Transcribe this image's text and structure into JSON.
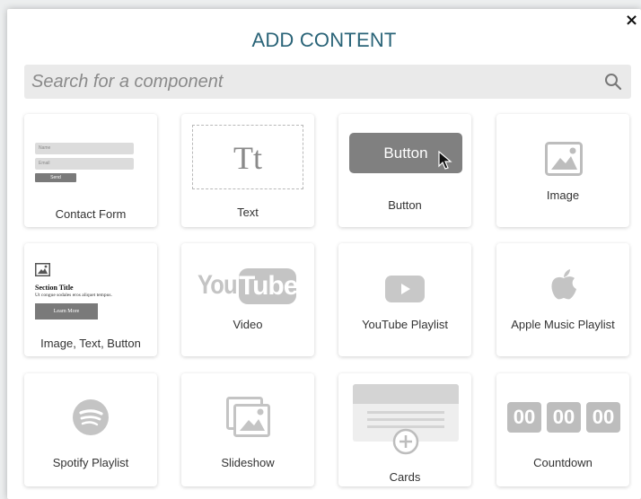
{
  "modal": {
    "title": "ADD CONTENT",
    "close_glyph": "×"
  },
  "search": {
    "placeholder": "Search for a component"
  },
  "components": [
    {
      "label": "Contact Form",
      "preview": {
        "name_field": "Name",
        "email_field": "Email",
        "send_button": "Send"
      }
    },
    {
      "label": "Text",
      "preview": {
        "glyph": "Tt"
      }
    },
    {
      "label": "Button",
      "preview": {
        "button_text": "Button"
      }
    },
    {
      "label": "Image",
      "preview": {
        "icon": "image-icon"
      }
    },
    {
      "label": "Image, Text, Button",
      "preview": {
        "section_title": "Section Title",
        "body": "Ut congue sodales eros aliquet tempus.",
        "button_text": "Learn More"
      }
    },
    {
      "label": "Video",
      "preview": {
        "logo_left": "You",
        "logo_right": "Tube"
      }
    },
    {
      "label": "YouTube Playlist",
      "preview": {
        "icon": "play-icon"
      }
    },
    {
      "label": "Apple Music Playlist",
      "preview": {
        "icon": "apple-icon"
      }
    },
    {
      "label": "Spotify Playlist",
      "preview": {
        "icon": "spotify-icon"
      }
    },
    {
      "label": "Slideshow",
      "preview": {
        "icon": "slideshow-icon"
      }
    },
    {
      "label": "Cards",
      "preview": {
        "icon": "cards-icon"
      }
    },
    {
      "label": "Countdown",
      "preview": {
        "digits": [
          "00",
          "00",
          "00"
        ]
      }
    }
  ],
  "colors": {
    "title": "#2a6478",
    "placeholder_gray": "#bdbdbd",
    "button_gray": "#7a7a7a"
  }
}
